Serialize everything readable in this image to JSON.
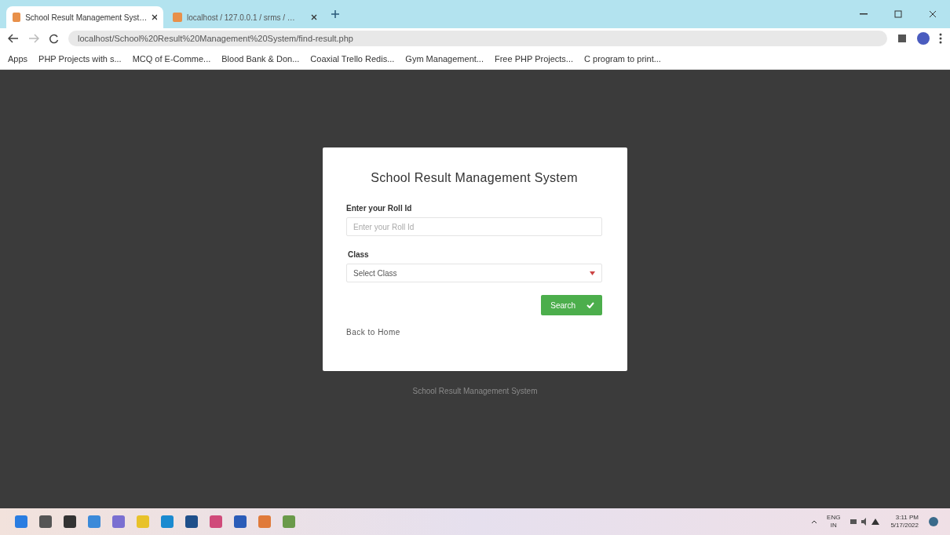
{
  "browser": {
    "tabs": [
      {
        "title": "School Result Management Syst…",
        "selected": true
      },
      {
        "title": "localhost / 127.0.0.1 / srms / …",
        "selected": false
      }
    ],
    "address": "localhost/School%20Result%20Management%20System/find-result.php",
    "bookmarks": [
      {
        "label": "Apps"
      },
      {
        "label": "PHP Projects with s..."
      },
      {
        "label": "MCQ of E-Comme..."
      },
      {
        "label": "Blood Bank & Don..."
      },
      {
        "label": "Coaxial Trello Redis..."
      },
      {
        "label": "Gym Management..."
      },
      {
        "label": "Free PHP Projects..."
      },
      {
        "label": "C program to print..."
      }
    ]
  },
  "card": {
    "title": "School Result Management System",
    "roll_label": "Enter your Roll Id",
    "roll_placeholder": "Enter your Roll Id",
    "class_label": "Class",
    "class_value": "Select Class",
    "search_button": "Search",
    "back_link": "Back to Home"
  },
  "footer": "School Result Management System",
  "taskbar": {
    "language": "ENG",
    "region": "IN",
    "time": "3:11 PM",
    "date": "5/17/2022"
  }
}
